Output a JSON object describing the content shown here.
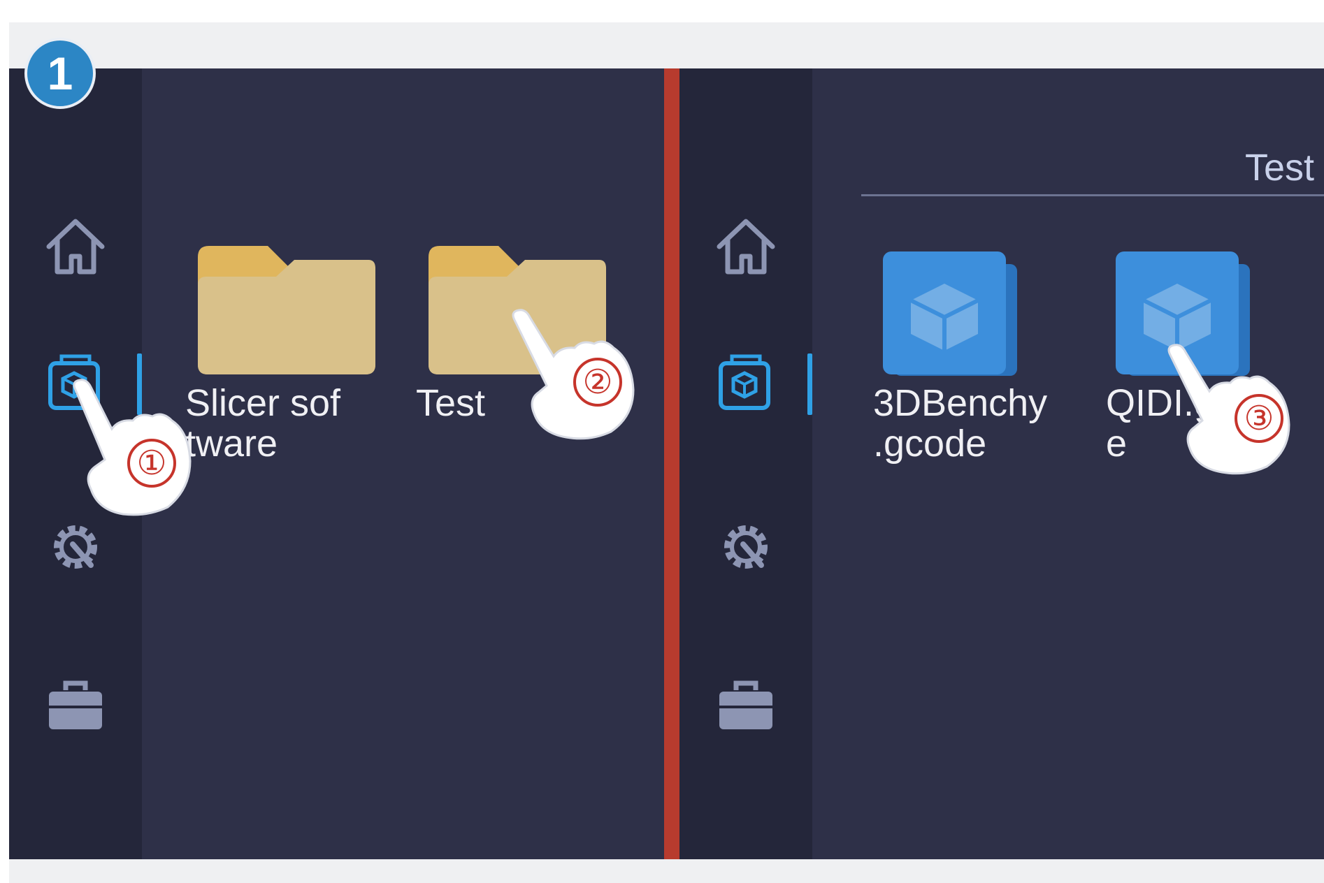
{
  "step": {
    "number": "1"
  },
  "left_screen": {
    "sidebar": {
      "items": [
        {
          "icon": "home-icon",
          "active": false
        },
        {
          "icon": "file-cube-icon",
          "active": true
        },
        {
          "icon": "gear-wrench-icon",
          "active": false
        },
        {
          "icon": "toolbox-icon",
          "active": false
        }
      ]
    },
    "folders": [
      {
        "label": "Slicer sof\ntware",
        "icon": "folder-icon"
      },
      {
        "label": "Test",
        "icon": "folder-icon"
      }
    ]
  },
  "right_screen": {
    "path_title": "Test",
    "sidebar": {
      "items": [
        {
          "icon": "home-icon",
          "active": false
        },
        {
          "icon": "file-cube-icon",
          "active": true
        },
        {
          "icon": "gear-wrench-icon",
          "active": false
        },
        {
          "icon": "toolbox-icon",
          "active": false
        }
      ]
    },
    "files": [
      {
        "label": "3DBenchy\n.gcode",
        "icon": "gcode-file-icon"
      },
      {
        "label": "QIDI.g\ne",
        "icon": "gcode-file-icon"
      }
    ]
  },
  "hints": [
    {
      "number": "①",
      "target": "files-nav"
    },
    {
      "number": "②",
      "target": "test-folder"
    },
    {
      "number": "③",
      "target": "qidi-file"
    }
  ],
  "colors": {
    "screen_bg": "#2e3048",
    "sidebar_bg": "#24263a",
    "accent": "#2fa1e6",
    "divider": "#b73b2e",
    "folder": "#dcc07c",
    "file_blue": "#3d8fdc",
    "hint_red": "#c6342b"
  }
}
